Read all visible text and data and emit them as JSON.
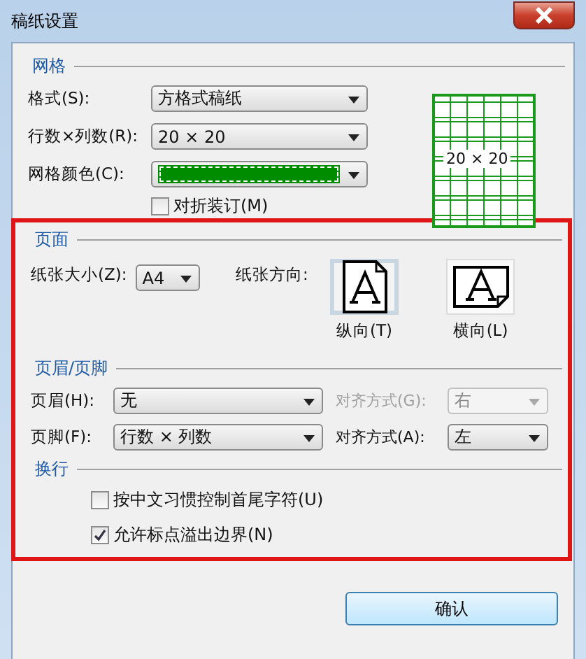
{
  "window": {
    "title": "稿纸设置"
  },
  "grid_section": {
    "title": "网格",
    "fields": [
      {
        "label": "格式(S):",
        "value": "方格式稿纸"
      },
      {
        "label": "行数×列数(R):",
        "value": "20 × 20"
      },
      {
        "label": "网格颜色(C):",
        "color": "#008c00"
      }
    ],
    "fold_binding": {
      "label": "对折装订(M)",
      "checked": false
    },
    "preview": {
      "text": "20 × 20"
    }
  },
  "highlight_frame": true,
  "page_section": {
    "title": "页面",
    "paper_size": {
      "label": "纸张大小(Z):",
      "value": "A4"
    },
    "orientation": {
      "label": "纸张方向:",
      "options": [
        {
          "label": "纵向(T)",
          "kind": "portrait",
          "selected": true
        },
        {
          "label": "横向(L)",
          "kind": "landscape",
          "selected": false
        }
      ]
    }
  },
  "header_footer_section": {
    "title": "页眉/页脚",
    "rows": [
      {
        "label": "页眉(H):",
        "value": "无",
        "align_label": "对齐方式(G):",
        "align_value": "右",
        "align_disabled": true
      },
      {
        "label": "页脚(F):",
        "value": "行数 × 列数",
        "align_label": "对齐方式(A):",
        "align_value": "左",
        "align_disabled": false
      }
    ]
  },
  "wrap_section": {
    "title": "换行",
    "options": [
      {
        "label": "按中文习惯控制首尾字符(U)",
        "checked": false
      },
      {
        "label": "允许标点溢出边界(N)",
        "checked": true
      }
    ]
  },
  "buttons": [
    "确认"
  ]
}
